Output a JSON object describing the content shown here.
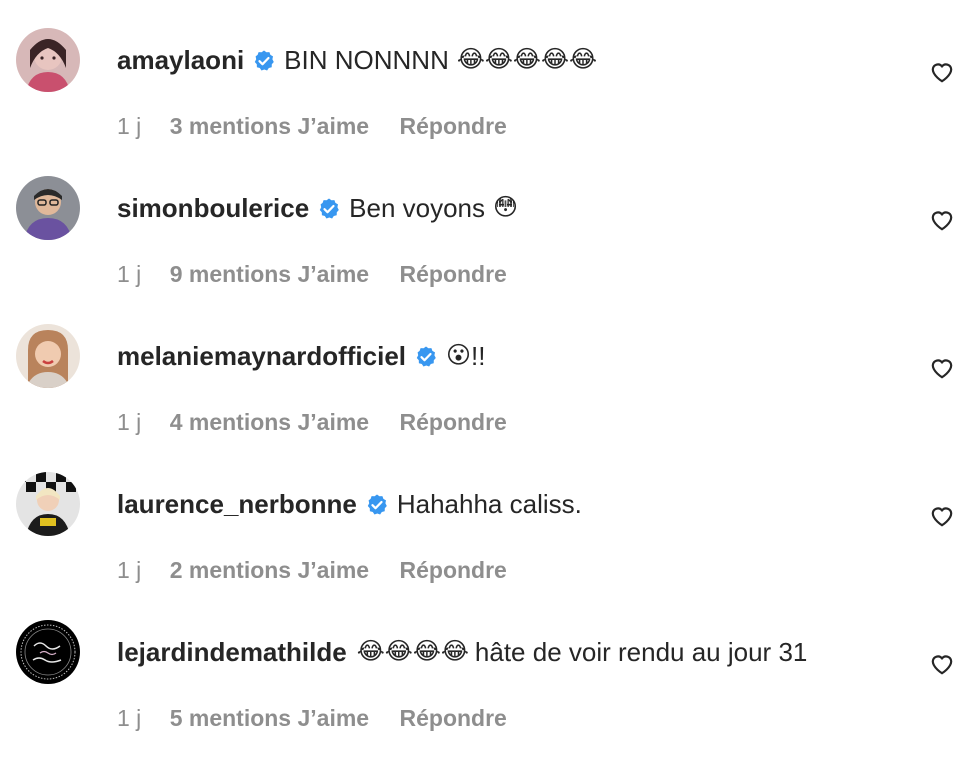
{
  "comments": [
    {
      "username": "amaylaoni",
      "verified": true,
      "text": "BIN NONNNN",
      "emoji": "😂😂😂😂😂",
      "time": "1 j",
      "likes": "3 mentions J’aime",
      "reply": "Répondre",
      "avatar_colors": [
        "#c9a3a7",
        "#5b3b3f",
        "#e8c5c0"
      ]
    },
    {
      "username": "simonboulerice",
      "verified": true,
      "text": "Ben voyons",
      "emoji": "😳",
      "time": "1 j",
      "likes": "9 mentions J’aime",
      "reply": "Répondre",
      "avatar_colors": [
        "#6c6f7a",
        "#3d3b5c",
        "#7c64a8"
      ]
    },
    {
      "username": "melaniemaynardofficiel",
      "verified": true,
      "text": "!!",
      "emoji": "😮",
      "time": "1 j",
      "likes": "4 mentions J’aime",
      "reply": "Répondre",
      "avatar_colors": [
        "#e5d4c7",
        "#a97a5a",
        "#d14a4a"
      ]
    },
    {
      "username": "laurence_nerbonne",
      "verified": true,
      "text": "Hahahha caliss.",
      "emoji": "",
      "time": "1 j",
      "likes": "2 mentions J’aime",
      "reply": "Répondre",
      "avatar_colors": [
        "#dedede",
        "#111111",
        "#e0c020"
      ]
    },
    {
      "username": "lejardindemathilde",
      "verified": false,
      "text": "hâte de voir rendu au jour 31",
      "emoji": "😂😂😂😂",
      "time": "1 j",
      "likes": "5 mentions J’aime",
      "reply": "Répondre",
      "avatar_colors": [
        "#000000",
        "#cccccc",
        "#ffffff"
      ]
    }
  ],
  "icons": {
    "verified": "verified-badge-icon",
    "like": "heart-outline-icon"
  },
  "colors": {
    "verified_blue": "#3897f0",
    "muted_text": "#8e8e8e",
    "primary_text": "#262626"
  }
}
